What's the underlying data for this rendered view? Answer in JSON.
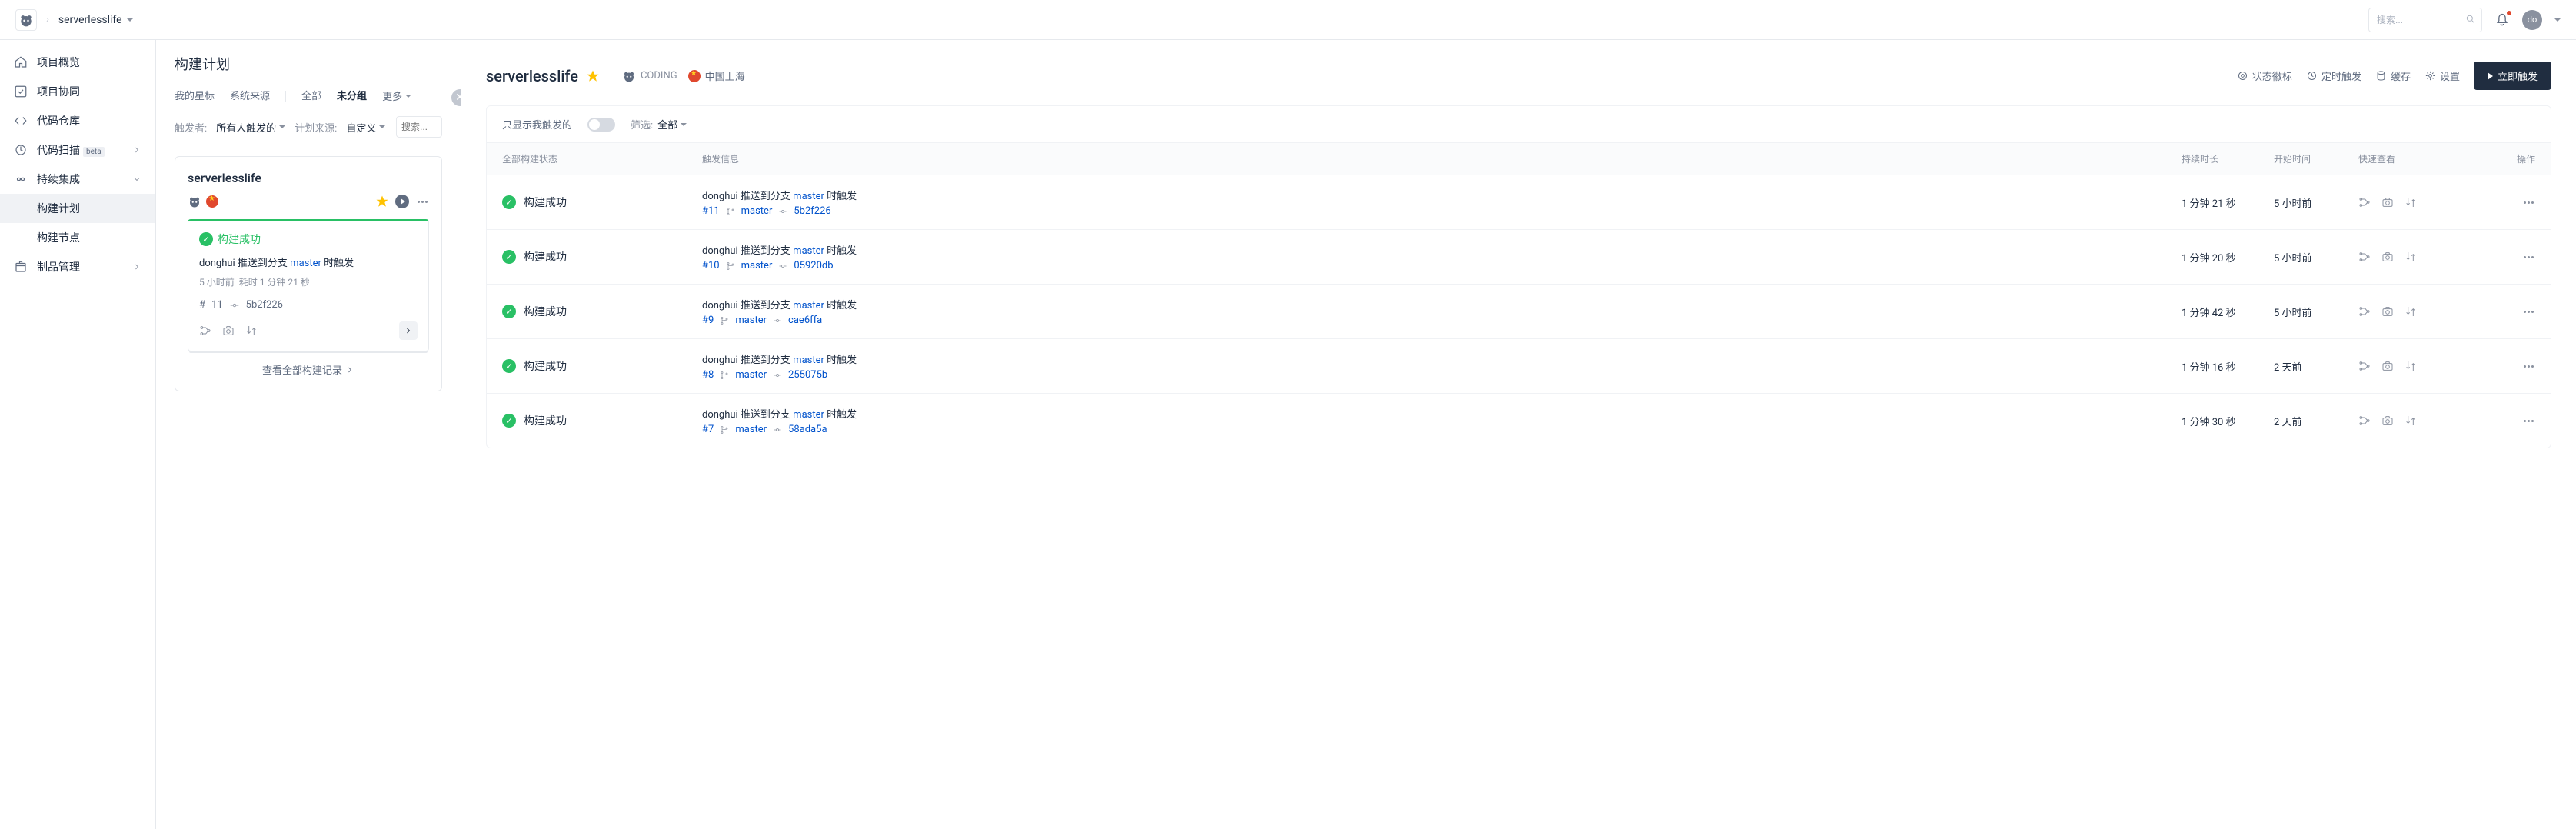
{
  "topbar": {
    "project": "serverlesslife",
    "search_placeholder": "搜索...",
    "avatar_text": "do"
  },
  "sidebar": {
    "items": [
      {
        "icon": "home",
        "label": "项目概览"
      },
      {
        "icon": "checkbox",
        "label": "项目协同"
      },
      {
        "icon": "code",
        "label": "代码仓库"
      },
      {
        "icon": "scan",
        "label": "代码扫描",
        "badge": "beta",
        "chevron": true
      },
      {
        "icon": "infinity",
        "label": "持续集成",
        "chevron": true,
        "expanded": true,
        "children": [
          {
            "label": "构建计划",
            "active": true
          },
          {
            "label": "构建节点"
          }
        ]
      },
      {
        "icon": "package",
        "label": "制品管理",
        "chevron": true
      }
    ]
  },
  "middle": {
    "title": "构建计划",
    "tabs": {
      "star": "我的星标",
      "source": "系统来源",
      "all": "全部",
      "ungrouped": "未分组",
      "more": "更多"
    },
    "filters": {
      "trigger_label": "触发者:",
      "trigger_value": "所有人触发的",
      "plan_label": "计划来源:",
      "plan_value": "自定义",
      "search_placeholder": "搜索..."
    },
    "card": {
      "title": "serverlesslife",
      "status": "构建成功",
      "trigger_prefix": "donghui 推送到分支",
      "trigger_branch": "master",
      "trigger_suffix": "时触发",
      "meta_time": "5 小时前",
      "meta_duration_label": "耗时",
      "meta_duration": "1 分钟 21 秒",
      "build_num": "11",
      "commit": "5b2f226",
      "view_all": "查看全部构建记录"
    }
  },
  "content": {
    "title": "serverlesslife",
    "coding_label": "CODING",
    "region": "中国上海",
    "actions": {
      "badge": "状态徽标",
      "cron": "定时触发",
      "cache": "缓存",
      "settings": "设置",
      "run": "立即触发"
    },
    "toolbar": {
      "mine_label": "只显示我触发的",
      "filter_label": "筛选:",
      "filter_value": "全部"
    },
    "columns": {
      "status": "全部构建状态",
      "trigger": "触发信息",
      "duration": "持续时长",
      "start": "开始时间",
      "quick": "快速查看",
      "op": "操作"
    },
    "rows": [
      {
        "status": "构建成功",
        "user": "donghui",
        "action_prefix": "推送到分支",
        "branch": "master",
        "action_suffix": "时触发",
        "num": "#11",
        "branch2": "master",
        "commit": "5b2f226",
        "duration": "1 分钟 21 秒",
        "start": "5 小时前"
      },
      {
        "status": "构建成功",
        "user": "donghui",
        "action_prefix": "推送到分支",
        "branch": "master",
        "action_suffix": "时触发",
        "num": "#10",
        "branch2": "master",
        "commit": "05920db",
        "duration": "1 分钟 20 秒",
        "start": "5 小时前"
      },
      {
        "status": "构建成功",
        "user": "donghui",
        "action_prefix": "推送到分支",
        "branch": "master",
        "action_suffix": "时触发",
        "num": "#9",
        "branch2": "master",
        "commit": "cae6ffa",
        "duration": "1 分钟 42 秒",
        "start": "5 小时前"
      },
      {
        "status": "构建成功",
        "user": "donghui",
        "action_prefix": "推送到分支",
        "branch": "master",
        "action_suffix": "时触发",
        "num": "#8",
        "branch2": "master",
        "commit": "255075b",
        "duration": "1 分钟 16 秒",
        "start": "2 天前"
      },
      {
        "status": "构建成功",
        "user": "donghui",
        "action_prefix": "推送到分支",
        "branch": "master",
        "action_suffix": "时触发",
        "num": "#7",
        "branch2": "master",
        "commit": "58ada5a",
        "duration": "1 分钟 30 秒",
        "start": "2 天前"
      }
    ]
  }
}
